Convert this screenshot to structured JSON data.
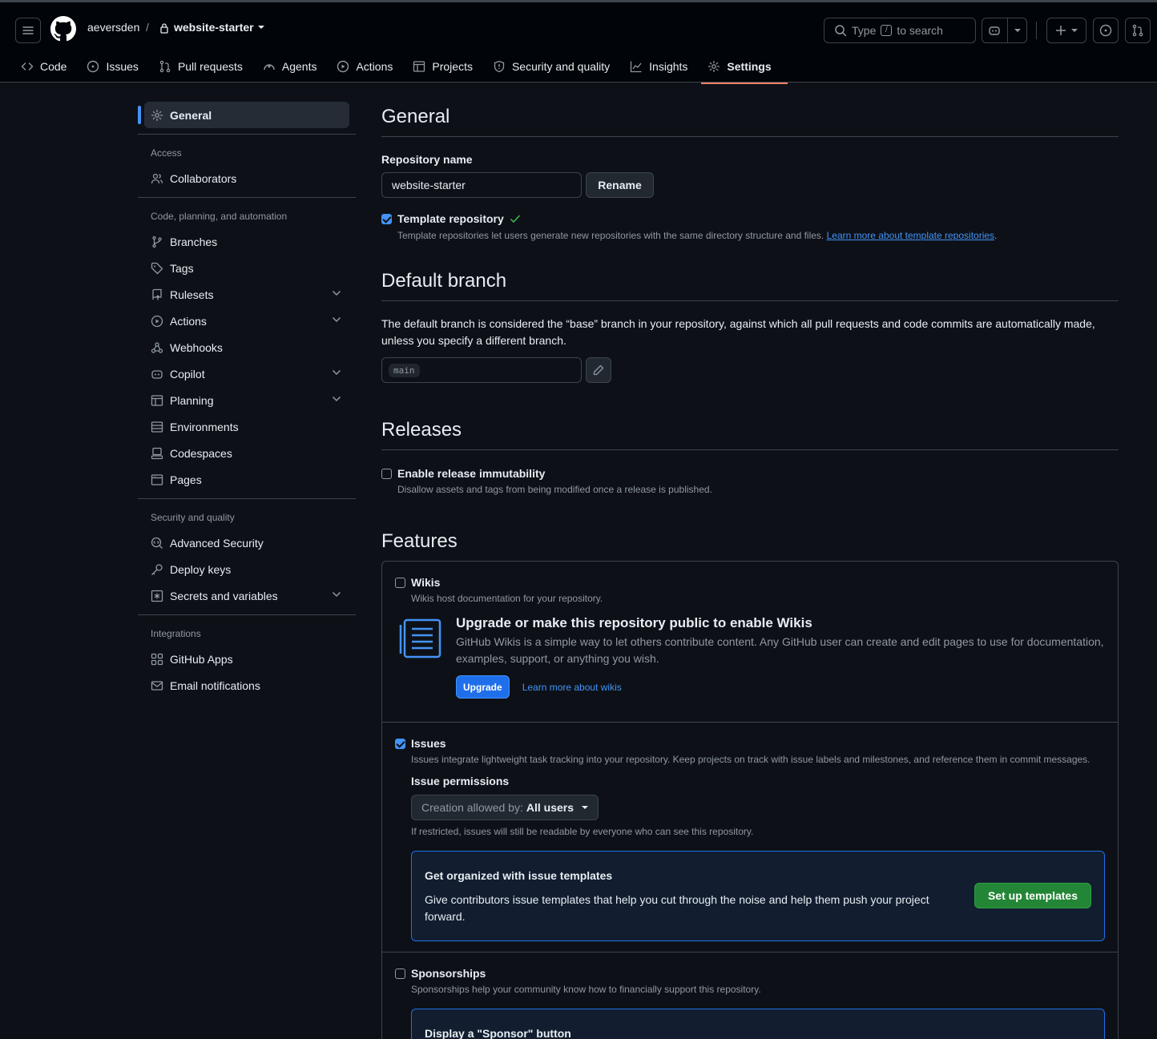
{
  "header": {
    "owner": "aeversden",
    "separator": "/",
    "repo": "website-starter",
    "search_prefix": "Type",
    "search_key": "/",
    "search_suffix": "to search"
  },
  "tabs": [
    {
      "label": "Code",
      "icon": "code-icon"
    },
    {
      "label": "Issues",
      "icon": "issue-icon"
    },
    {
      "label": "Pull requests",
      "icon": "pull-request-icon"
    },
    {
      "label": "Agents",
      "icon": "agent-icon"
    },
    {
      "label": "Actions",
      "icon": "play-icon"
    },
    {
      "label": "Projects",
      "icon": "table-icon"
    },
    {
      "label": "Security and quality",
      "icon": "shield-icon"
    },
    {
      "label": "Insights",
      "icon": "graph-icon"
    },
    {
      "label": "Settings",
      "icon": "gear-icon",
      "active": true
    }
  ],
  "sidebar": {
    "general": "General",
    "access_heading": "Access",
    "collaborators": "Collaborators",
    "code_heading": "Code, planning, and automation",
    "branches": "Branches",
    "tags": "Tags",
    "rulesets": "Rulesets",
    "actions": "Actions",
    "webhooks": "Webhooks",
    "copilot": "Copilot",
    "planning": "Planning",
    "environments": "Environments",
    "codespaces": "Codespaces",
    "pages": "Pages",
    "security_heading": "Security and quality",
    "advanced_security": "Advanced Security",
    "deploy_keys": "Deploy keys",
    "secrets": "Secrets and variables",
    "integrations_heading": "Integrations",
    "github_apps": "GitHub Apps",
    "email_notifications": "Email notifications"
  },
  "general": {
    "title": "General",
    "repo_name_label": "Repository name",
    "repo_name_value": "website-starter",
    "rename_button": "Rename",
    "template_label": "Template repository",
    "template_checked": true,
    "template_note": "Template repositories let users generate new repositories with the same directory structure and files.",
    "template_link": "Learn more about template repositories",
    "template_link_suffix": "."
  },
  "default_branch": {
    "title": "Default branch",
    "description": "The default branch is considered the “base” branch in your repository, against which all pull requests and code commits are automatically made, unless you specify a different branch.",
    "branch": "main"
  },
  "releases": {
    "title": "Releases",
    "immutability_label": "Enable release immutability",
    "immutability_checked": false,
    "immutability_note": "Disallow assets and tags from being modified once a release is published."
  },
  "features": {
    "title": "Features",
    "wikis": {
      "label": "Wikis",
      "checked": false,
      "note": "Wikis host documentation for your repository.",
      "upgrade_title": "Upgrade or make this repository public to enable Wikis",
      "upgrade_body": "GitHub Wikis is a simple way to let others contribute content. Any GitHub user can create and edit pages to use for documentation, examples, support, or anything you wish.",
      "upgrade_button": "Upgrade",
      "learn_link": "Learn more about wikis"
    },
    "issues": {
      "label": "Issues",
      "checked": true,
      "note": "Issues integrate lightweight task tracking into your repository. Keep projects on track with issue labels and milestones, and reference them in commit messages.",
      "permissions_label": "Issue permissions",
      "select_prefix": "Creation allowed by:",
      "select_value": "All users",
      "restricted_note": "If restricted, issues will still be readable by everyone who can see this repository.",
      "templates_title": "Get organized with issue templates",
      "templates_body": "Give contributors issue templates that help you cut through the noise and help them push your project forward.",
      "templates_button": "Set up templates"
    },
    "sponsorships": {
      "label": "Sponsorships",
      "checked": false,
      "note": "Sponsorships help your community know how to financially support this repository.",
      "callout_title": "Display a \"Sponsor\" button"
    }
  },
  "colors": {
    "background": "#0d1117",
    "header": "#010409",
    "border": "#3d444d",
    "accent": "#4493f8",
    "tab_underline": "#f78166",
    "green": "#238636"
  }
}
